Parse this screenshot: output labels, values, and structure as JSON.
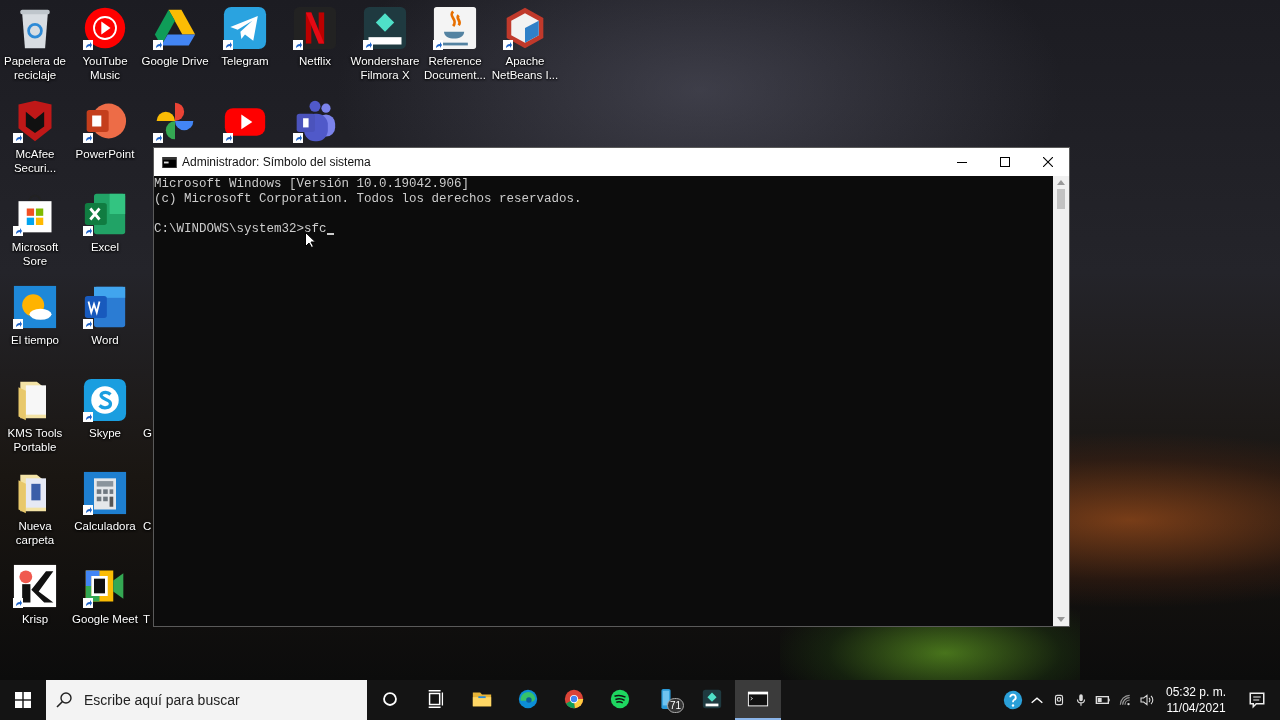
{
  "desktop": {
    "columns": [
      [
        {
          "kind": "recycle",
          "label": "Papelera de reciclaje",
          "shortcut": false
        },
        {
          "kind": "mcafee",
          "label": "McAfee Securi...",
          "shortcut": true
        },
        {
          "kind": "store",
          "label": "Microsoft Sore",
          "shortcut": true
        },
        {
          "kind": "weather",
          "label": "El tiempo",
          "shortcut": true
        },
        {
          "kind": "folder",
          "label": "KMS Tools Portable",
          "shortcut": false
        },
        {
          "kind": "folder_r",
          "label": "Nueva carpeta",
          "shortcut": false
        },
        {
          "kind": "krisp",
          "label": "Krisp",
          "shortcut": true
        }
      ],
      [
        {
          "kind": "ytmusic",
          "label": "YouTube Music",
          "shortcut": true
        },
        {
          "kind": "powerpoint",
          "label": "PowerPoint",
          "shortcut": true
        },
        {
          "kind": "excel",
          "label": "Excel",
          "shortcut": true
        },
        {
          "kind": "word",
          "label": "Word",
          "shortcut": true
        },
        {
          "kind": "skype",
          "label": "Skype",
          "shortcut": true
        },
        {
          "kind": "calculator",
          "label": "Calculadora",
          "shortcut": true
        },
        {
          "kind": "meet",
          "label": "Google Meet",
          "shortcut": true
        }
      ],
      [
        {
          "kind": "gdrive",
          "label": "Google Drive",
          "shortcut": true
        },
        {
          "kind": "photos",
          "shortcut": true
        },
        {
          "kind": "covered"
        },
        {
          "kind": "covered"
        },
        {
          "kind": "covered",
          "label": "G"
        },
        {
          "kind": "covered",
          "label": "C"
        },
        {
          "kind": "covered",
          "label": "T"
        }
      ],
      [
        {
          "kind": "telegram",
          "label": "Telegram",
          "shortcut": true
        },
        {
          "kind": "youtube",
          "shortcut": true
        }
      ],
      [
        {
          "kind": "netflix",
          "label": "Netflix",
          "shortcut": true
        },
        {
          "kind": "teams",
          "shortcut": true
        }
      ],
      [
        {
          "kind": "filmora",
          "label": "Wondershare Filmora X",
          "shortcut": true
        }
      ],
      [
        {
          "kind": "java",
          "label": "Reference Document...",
          "shortcut": true
        }
      ],
      [
        {
          "kind": "netbeans",
          "label": "Apache NetBeans I...",
          "shortcut": true
        }
      ]
    ]
  },
  "window": {
    "title": "Administrador: Símbolo del sistema",
    "output_lines": [
      "Microsoft Windows [Versión 10.0.19042.906]",
      "(c) Microsoft Corporation. Todos los derechos reservados."
    ],
    "prompt": "C:\\WINDOWS\\system32>",
    "input": "sfc"
  },
  "taskbar": {
    "search": {
      "placeholder": "Escribe aquí para buscar"
    },
    "apps": [
      {
        "kind": "cortana",
        "selected": false
      },
      {
        "kind": "taskview",
        "selected": false
      },
      {
        "kind": "explorer",
        "selected": false
      },
      {
        "kind": "edge",
        "selected": false
      },
      {
        "kind": "chrome",
        "selected": false
      },
      {
        "kind": "spotify",
        "selected": false
      },
      {
        "kind": "phone",
        "selected": false,
        "badge": "71"
      },
      {
        "kind": "filmora",
        "selected": false
      },
      {
        "kind": "cmd",
        "selected": true
      }
    ],
    "tray": [
      {
        "kind": "help"
      },
      {
        "kind": "chevron"
      },
      {
        "kind": "camera"
      },
      {
        "kind": "mic"
      },
      {
        "kind": "battery"
      },
      {
        "kind": "wifi"
      },
      {
        "kind": "volume"
      }
    ],
    "time": "05:32 p. m.",
    "date": "11/04/2021"
  }
}
